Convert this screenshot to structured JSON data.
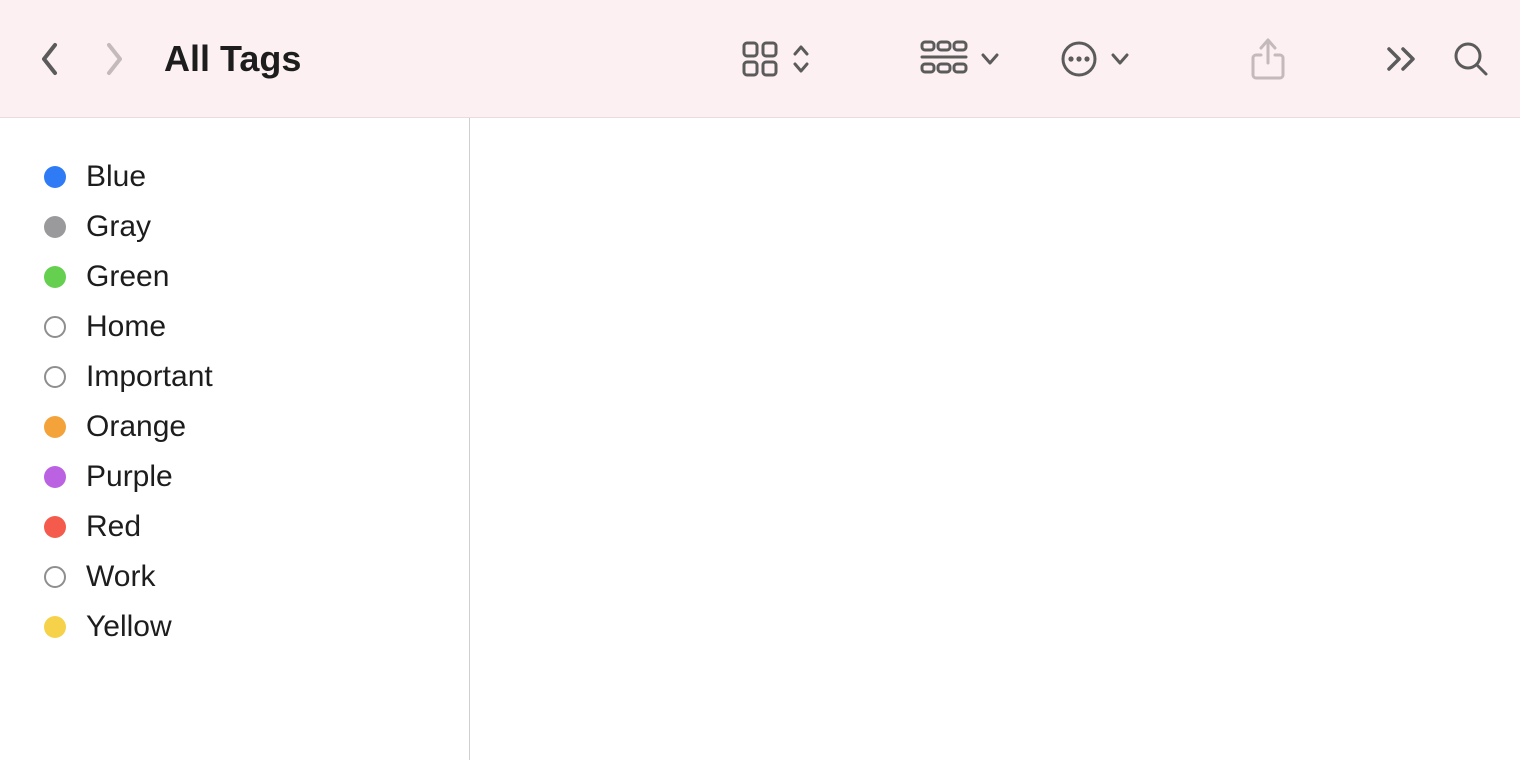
{
  "header": {
    "title": "All Tags"
  },
  "sidebar": {
    "tags": [
      {
        "label": "Blue",
        "color": "#2f7bf6",
        "hollow": false
      },
      {
        "label": "Gray",
        "color": "#9a9a9c",
        "hollow": false
      },
      {
        "label": "Green",
        "color": "#65d050",
        "hollow": false
      },
      {
        "label": "Home",
        "color": "",
        "hollow": true
      },
      {
        "label": "Important",
        "color": "",
        "hollow": true
      },
      {
        "label": "Orange",
        "color": "#f4a33b",
        "hollow": false
      },
      {
        "label": "Purple",
        "color": "#bb62e3",
        "hollow": false
      },
      {
        "label": "Red",
        "color": "#f55b4c",
        "hollow": false
      },
      {
        "label": "Work",
        "color": "",
        "hollow": true
      },
      {
        "label": "Yellow",
        "color": "#f6d24a",
        "hollow": false
      }
    ]
  },
  "icons": {
    "back": "chevron-left-icon",
    "forward": "chevron-right-icon",
    "view": "grid-view-icon",
    "group": "group-by-icon",
    "actions": "more-actions-icon",
    "share": "share-icon",
    "overflow": "overflow-icon",
    "search": "search-icon"
  }
}
